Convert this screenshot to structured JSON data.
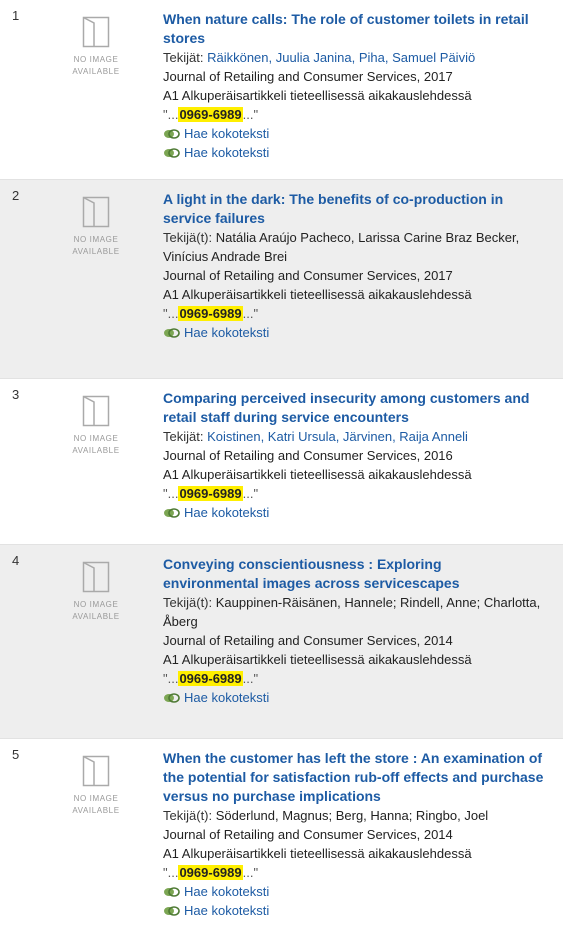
{
  "results": [
    {
      "number": "1",
      "no_image_text": [
        "NO IMAGE",
        "AVAILABLE"
      ],
      "title": "When nature calls: The role of customer toilets in retail stores",
      "authors_label": "Tekijät:",
      "authors": "Räikkönen, Juulia Janina, Piha, Samuel Päiviö",
      "authors_linked": true,
      "source": "Journal of Retailing and Consumer Services, 2017",
      "type": "A1 Alkuperäisartikkeli tieteellisessä aikakauslehdessä",
      "snippet_prefix": "\"...",
      "snippet_highlight": "0969-6989",
      "snippet_suffix": "...\"",
      "fulltext_links": [
        "Hae kokoteksti",
        "Hae kokoteksti"
      ]
    },
    {
      "number": "2",
      "no_image_text": [
        "NO IMAGE",
        "AVAILABLE"
      ],
      "title": "A light in the dark: The benefits of co-production in service failures",
      "authors_label": "Tekijä(t):",
      "authors": "Natália Araújo Pacheco, Larissa Carine Braz Becker, Vinícius Andrade Brei",
      "authors_linked": false,
      "source": "Journal of Retailing and Consumer Services, 2017",
      "type": "A1 Alkuperäisartikkeli tieteellisessä aikakauslehdessä",
      "snippet_prefix": "\"...",
      "snippet_highlight": "0969-6989",
      "snippet_suffix": "...\"",
      "fulltext_links": [
        "Hae kokoteksti"
      ]
    },
    {
      "number": "3",
      "no_image_text": [
        "NO IMAGE",
        "AVAILABLE"
      ],
      "title": "Comparing perceived insecurity among customers and retail staff during service encounters",
      "authors_label": "Tekijät:",
      "authors": "Koistinen, Katri Ursula, Järvinen, Raija Anneli",
      "authors_linked": true,
      "source": "Journal of Retailing and Consumer Services, 2016",
      "type": "A1 Alkuperäisartikkeli tieteellisessä aikakauslehdessä",
      "snippet_prefix": "\"...",
      "snippet_highlight": "0969-6989",
      "snippet_suffix": "...\"",
      "fulltext_links": [
        "Hae kokoteksti"
      ]
    },
    {
      "number": "4",
      "no_image_text": [
        "NO IMAGE",
        "AVAILABLE"
      ],
      "title": "Conveying conscientiousness : Exploring environmental images across servicescapes",
      "authors_label": "Tekijä(t):",
      "authors": "Kauppinen-Räisänen, Hannele; Rindell, Anne; Charlotta, Åberg",
      "authors_linked": false,
      "source": "Journal of Retailing and Consumer Services, 2014",
      "type": "A1 Alkuperäisartikkeli tieteellisessä aikakauslehdessä",
      "snippet_prefix": "\"...",
      "snippet_highlight": "0969-6989",
      "snippet_suffix": "...\"",
      "fulltext_links": [
        "Hae kokoteksti"
      ]
    },
    {
      "number": "5",
      "no_image_text": [
        "NO IMAGE",
        "AVAILABLE"
      ],
      "title": "When the customer has left the store : An examination of the potential for satisfaction rub-off effects and purchase versus no purchase implications",
      "authors_label": "Tekijä(t):",
      "authors": "Söderlund, Magnus; Berg, Hanna; Ringbo, Joel",
      "authors_linked": false,
      "source": "Journal of Retailing and Consumer Services, 2014",
      "type": "A1 Alkuperäisartikkeli tieteellisessä aikakauslehdessä",
      "snippet_prefix": "\"...",
      "snippet_highlight": "0969-6989",
      "snippet_suffix": "...\"",
      "fulltext_links": [
        "Hae kokoteksti",
        "Hae kokoteksti"
      ]
    }
  ],
  "colors": {
    "link": "#1d5ba4",
    "highlight": "#ffef00",
    "alt_row": "#eeeeee"
  }
}
